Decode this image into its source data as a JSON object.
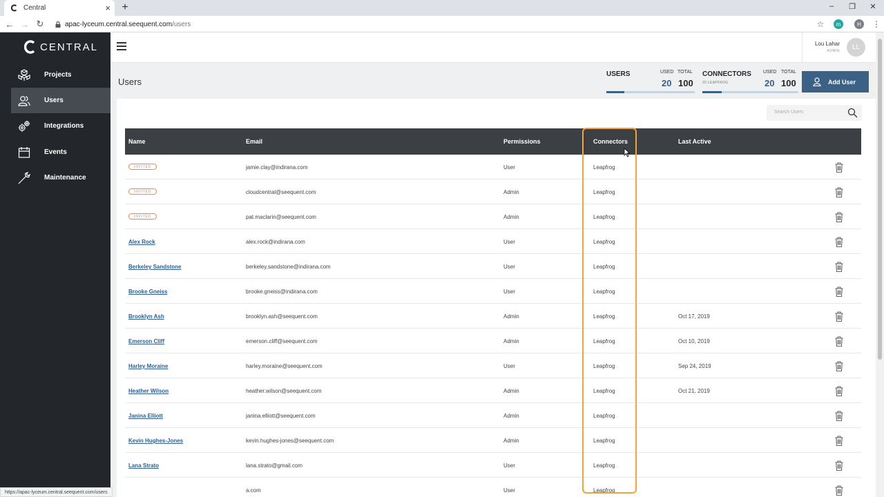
{
  "browser": {
    "tab_title": "Central",
    "new_tab": "+",
    "url_host": "apac-lyceum.central.seequent.com",
    "url_path": "/users",
    "ext_label": "m",
    "profile_initial": "H",
    "status_url": "https://apac-lyceum.central.seequent.com/users"
  },
  "sidebar": {
    "brand": "CENTRAL",
    "items": [
      {
        "label": "Projects",
        "icon": "projects-icon"
      },
      {
        "label": "Users",
        "icon": "users-icon",
        "active": true
      },
      {
        "label": "Integrations",
        "icon": "integrations-icon"
      },
      {
        "label": "Events",
        "icon": "events-icon"
      },
      {
        "label": "Maintenance",
        "icon": "maintenance-icon"
      }
    ]
  },
  "header": {
    "user_name": "Lou Lahar",
    "user_role": "ADMIN",
    "avatar_initials": "LL"
  },
  "page": {
    "title": "Users",
    "users_stat": {
      "label": "USERS",
      "used_label": "USED",
      "total_label": "TOTAL",
      "used": "20",
      "total": "100",
      "fill_fraction": 0.2
    },
    "connectors_stat": {
      "label": "CONNECTORS",
      "sub": "20 LEAPFROG",
      "used_label": "USED",
      "total_label": "TOTAL",
      "used": "20",
      "total": "100",
      "fill_fraction": 0.2
    },
    "add_user": "Add User",
    "search_placeholder": "Search Users"
  },
  "table": {
    "columns": [
      "Name",
      "Email",
      "Permissions",
      "Connectors",
      "Last Active"
    ],
    "invited_label": "INVITED",
    "rows": [
      {
        "name": "",
        "invited": true,
        "email": "jamie.clay@indirana.com",
        "permission": "User",
        "connector": "Leapfrog",
        "last_active": ""
      },
      {
        "name": "",
        "invited": true,
        "email": "cloudcentral@seequent.com",
        "permission": "Admin",
        "connector": "Leapfrog",
        "last_active": ""
      },
      {
        "name": "",
        "invited": true,
        "email": "pat.maclarin@seequent.com",
        "permission": "Admin",
        "connector": "Leapfrog",
        "last_active": ""
      },
      {
        "name": "Alex Rock",
        "invited": false,
        "email": "alex.rock@indirana.com",
        "permission": "User",
        "connector": "Leapfrog",
        "last_active": ""
      },
      {
        "name": "Berkeley Sandstone",
        "invited": false,
        "email": "berkeley.sandstone@indirana.com",
        "permission": "User",
        "connector": "Leapfrog",
        "last_active": ""
      },
      {
        "name": "Brooke Gneiss",
        "invited": false,
        "email": "brooke.gneiss@indirana.com",
        "permission": "User",
        "connector": "Leapfrog",
        "last_active": ""
      },
      {
        "name": "Brooklyn Ash",
        "invited": false,
        "email": "brooklyn.ash@seequent.com",
        "permission": "Admin",
        "connector": "Leapfrog",
        "last_active": "Oct 17, 2019"
      },
      {
        "name": "Emerson Cliff",
        "invited": false,
        "email": "emerson.cliff@seequent.com",
        "permission": "Admin",
        "connector": "Leapfrog",
        "last_active": "Oct 10, 2019"
      },
      {
        "name": "Harley Moraine",
        "invited": false,
        "email": "harley.moraine@seequent.com",
        "permission": "User",
        "connector": "Leapfrog",
        "last_active": "Sep 24, 2019"
      },
      {
        "name": "Heather Wilson",
        "invited": false,
        "email": "heather.wilson@seequent.com",
        "permission": "Admin",
        "connector": "Leapfrog",
        "last_active": "Oct 21, 2019"
      },
      {
        "name": "Janina Elliott",
        "invited": false,
        "email": "janina.elliott@seequent.com",
        "permission": "Admin",
        "connector": "Leapfrog",
        "last_active": ""
      },
      {
        "name": "Kevin Hughes-Jones",
        "invited": false,
        "email": "kevin.hughes-jones@seequent.com",
        "permission": "Admin",
        "connector": "Leapfrog",
        "last_active": ""
      },
      {
        "name": "Lana Strato",
        "invited": false,
        "email": "lana.strato@gmail.com",
        "permission": "User",
        "connector": "Leapfrog",
        "last_active": ""
      },
      {
        "name": "",
        "invited": false,
        "email": "a.com",
        "permission": "User",
        "connector": "Leapfrog",
        "last_active": ""
      }
    ]
  },
  "colors": {
    "sidebar_bg": "#23272c",
    "accent_blue": "#3b6184",
    "table_header": "#3c3f43",
    "invited_orange": "#e08a45",
    "highlight_orange": "#f2a33a"
  }
}
